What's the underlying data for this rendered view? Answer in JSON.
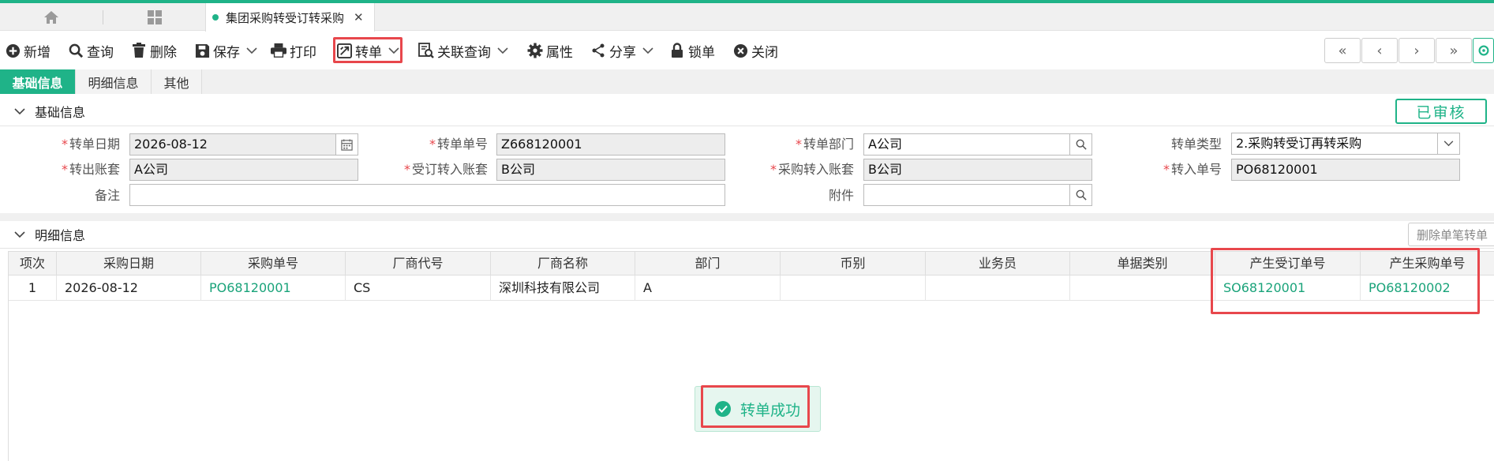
{
  "tabs": {
    "home_icon": "home-icon",
    "apps_icon": "grid-icon",
    "document_tab": "集团采购转受订转采购",
    "close_icon": "close-icon"
  },
  "toolbar": {
    "new": "新增",
    "query": "查询",
    "delete": "删除",
    "save": "保存",
    "print": "打印",
    "transfer": "转单",
    "related_query": "关联查询",
    "properties": "属性",
    "share": "分享",
    "lock": "锁单",
    "close": "关闭"
  },
  "subtabs": [
    "基础信息",
    "明细信息",
    "其他"
  ],
  "basic_section": {
    "title": "基础信息",
    "status_badge": "已审核",
    "fields": {
      "transfer_date": {
        "label": "转单日期",
        "value": "2026-08-12"
      },
      "transfer_no": {
        "label": "转单单号",
        "value": "Z668120001"
      },
      "transfer_dept": {
        "label": "转单部门",
        "value": "A公司"
      },
      "transfer_type": {
        "label": "转单类型",
        "value": "2.采购转受订再转采购"
      },
      "out_account": {
        "label": "转出账套",
        "value": "A公司"
      },
      "order_in_account": {
        "label": "受订转入账套",
        "value": "B公司"
      },
      "purchase_in_account": {
        "label": "采购转入账套",
        "value": "B公司"
      },
      "in_no": {
        "label": "转入单号",
        "value": "PO68120001"
      },
      "remark": {
        "label": "备注",
        "value": ""
      },
      "attachment": {
        "label": "附件",
        "value": ""
      }
    }
  },
  "detail_section": {
    "title": "明细信息",
    "delete_single_button": "删除单笔转单",
    "columns": [
      "项次",
      "采购日期",
      "采购单号",
      "厂商代号",
      "厂商名称",
      "部门",
      "币别",
      "业务员",
      "单据类别",
      "产生受订单号",
      "产生采购单号"
    ],
    "rows": [
      {
        "item": "1",
        "purchase_date": "2026-08-12",
        "purchase_no": "PO68120001",
        "vendor_code": "CS",
        "vendor_name": "深圳科技有限公司",
        "dept": "A",
        "currency": "",
        "salesperson": "",
        "doc_type": "",
        "gen_order_no": "SO68120001",
        "gen_purchase_no": "PO68120002"
      }
    ]
  },
  "toast": {
    "message": "转单成功"
  },
  "colors": {
    "accent": "#1fb388",
    "highlight": "#e8474c"
  }
}
